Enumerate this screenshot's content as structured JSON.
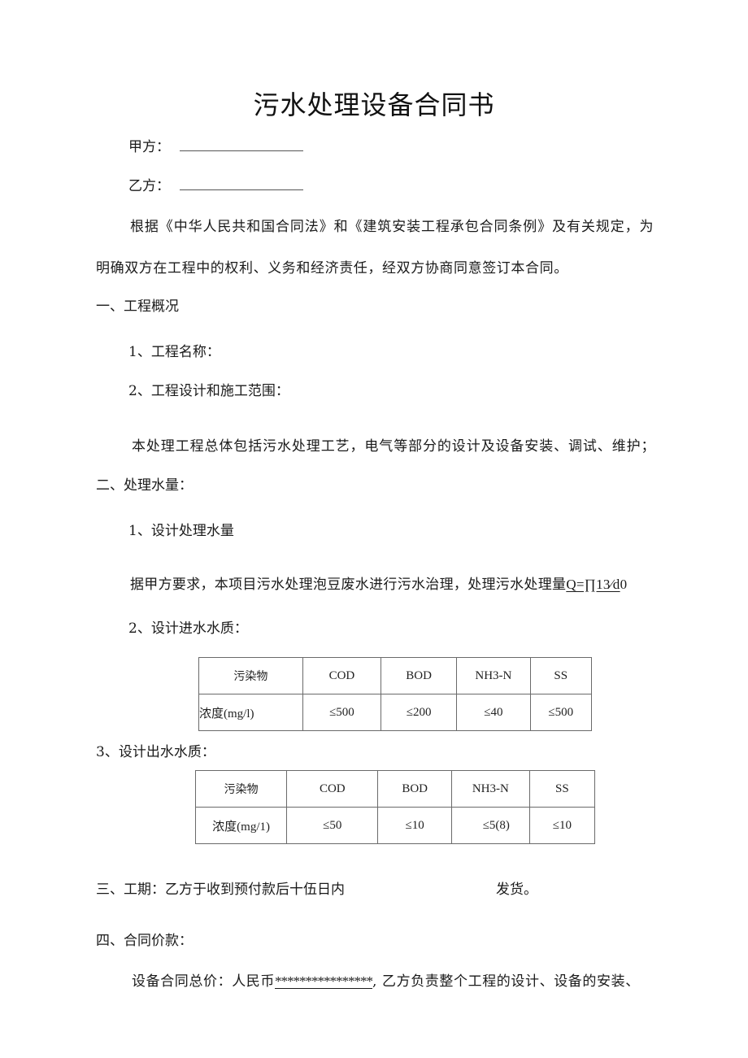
{
  "document": {
    "title": "污水处理设备合同书",
    "party_a_label": "甲方：",
    "party_b_label": "乙方：",
    "intro_line1": "根据《中华人民共和国合同法》和《建筑安装工程承包合同条例》及有关规定，为",
    "intro_line2": "明确双方在工程中的权利、义务和经济责任，经双方协商同意签订本合同。",
    "section1": {
      "heading": "一、工程概况",
      "item1": "1、工程名称：",
      "item2": "2、工程设计和施工范围：",
      "scope_text": "本处理工程总体包括污水处理工艺，电气等部分的设计及设备安装、调试、维护；"
    },
    "section2": {
      "heading": "二、处理水量：",
      "item1": "1、设计处理水量",
      "capacity_text": "据甲方要求，本项目污水处理泡豆废水进行污水治理，处理污水处理量",
      "capacity_value": "Q=∏13∕d",
      "capacity_suffix": "0",
      "item2": "2、设计进水水质：",
      "inlet_table": {
        "headers": [
          "污染物",
          "COD",
          "BOD",
          "NH3-N",
          "SS"
        ],
        "row": [
          "浓度(mg/l)",
          "≤500",
          "≤200",
          "≤40",
          "≤500"
        ]
      },
      "item3": "3、设计出水水质：",
      "outlet_table": {
        "headers": [
          "污染物",
          "COD",
          "BOD",
          "NH3-N",
          "SS"
        ],
        "row": [
          "浓度(mg/1)",
          "≤50",
          "≤10",
          "≤5(8)",
          "≤10"
        ]
      }
    },
    "section3": {
      "text": "三、工期：乙方于收到预付款后十伍日内",
      "suffix": "发货。"
    },
    "section4": {
      "heading": "四、合同价款：",
      "price_prefix": "设备合同总价：人民币",
      "price_masked": "****************",
      "price_suffix": ", 乙方负责整个工程的设计、设备的安装、"
    }
  }
}
